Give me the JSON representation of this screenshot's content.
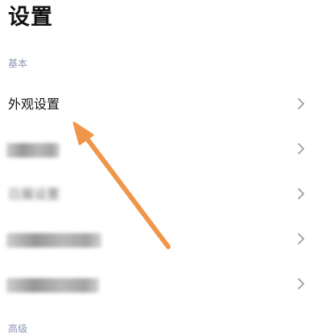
{
  "header": {
    "title": "设置"
  },
  "sections": [
    {
      "label": "基本",
      "items": [
        {
          "label": "外观设置",
          "blurred": false
        },
        {
          "label": "",
          "blurred": true
        },
        {
          "label": "日展设置",
          "blurred": true
        },
        {
          "label": "",
          "blurred": true
        },
        {
          "label": "",
          "blurred": true
        }
      ]
    },
    {
      "label": "高级",
      "items": []
    }
  ],
  "icons": {
    "row_chevron": "chevron-right-icon",
    "annotation": "orange-arrow"
  },
  "colors": {
    "section_header": "#8a96b4",
    "chevron": "#9e9e9e",
    "annotation_arrow": "#f0964a",
    "background": "#ffffff"
  }
}
